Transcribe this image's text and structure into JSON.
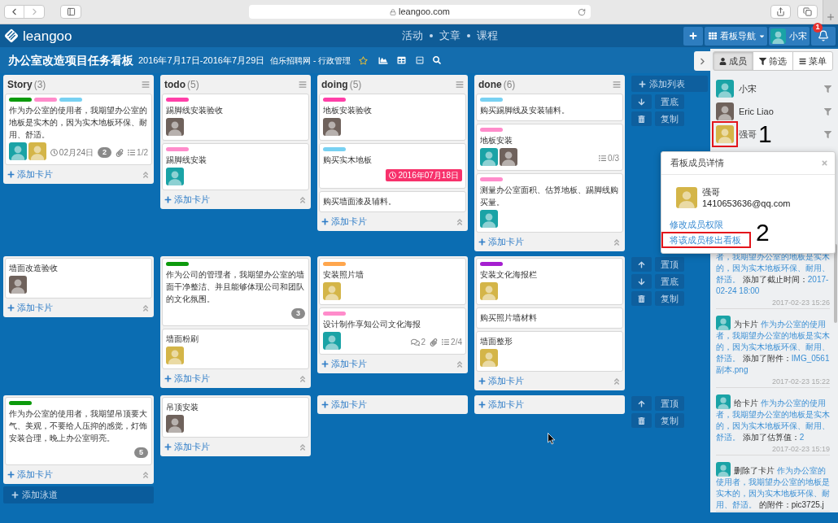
{
  "browser": {
    "url": "leangoo.com"
  },
  "header": {
    "logo": "leangoo",
    "nav": [
      "活动",
      "文章",
      "课程"
    ],
    "board_nav": "看板导航",
    "user": {
      "name": "小宋",
      "avatar": {
        "color": "#1aa3a6"
      }
    },
    "notifications": "1"
  },
  "board": {
    "title": "办公室改造项目任务看板",
    "dates": "2016年7月17日-2016年7月29日",
    "team": "伯乐招聘网 - 行政管理"
  },
  "lists": [
    {
      "name": "Story",
      "count": "(3)"
    },
    {
      "name": "todo",
      "count": "(5)"
    },
    {
      "name": "doing",
      "count": "(5)"
    },
    {
      "name": "done",
      "count": "(6)"
    }
  ],
  "lanes": [
    {
      "add_list": "添加列表",
      "columns": [
        {
          "cards": [
            {
              "labels": [
                {
                  "color": "#0c9a0c"
                },
                {
                  "color": "#ff8ccb"
                },
                {
                  "color": "#78d1f2"
                }
              ],
              "title": "作为办公室的使用者，我期望办公室的地板是实木的，因为实木地板环保、耐用、舒适。",
              "avatars": [
                {
                  "color": "#1aa3a6"
                },
                {
                  "color": "#d4b548"
                }
              ],
              "due": {
                "text": "02月24日",
                "overdue": false
              },
              "estimate": "2",
              "attachment": true,
              "checklist": "1/2"
            }
          ],
          "add_card": "添加卡片"
        },
        {
          "cards": [
            {
              "labels": [
                {
                  "color": "#ff3fa8"
                }
              ],
              "title": "踢脚线安装验收",
              "avatars": [
                {
                  "color": "#6f625c"
                }
              ]
            },
            {
              "labels": [
                {
                  "color": "#ff8ccb"
                }
              ],
              "title": "踢脚线安装",
              "avatars": [
                {
                  "color": "#1aa3a6"
                }
              ]
            }
          ],
          "add_card": "添加卡片"
        },
        {
          "cards": [
            {
              "labels": [
                {
                  "color": "#ff3fa8"
                }
              ],
              "title": "地板安装验收",
              "avatars": [
                {
                  "color": "#6f625c"
                }
              ]
            },
            {
              "labels": [
                {
                  "color": "#78d1f2"
                }
              ],
              "title": "购买实木地板",
              "due": {
                "text": "2016年07月18日",
                "overdue": true
              }
            },
            {
              "title": "购买墙面漆及辅料。"
            }
          ],
          "add_card": "添加卡片"
        },
        {
          "cards": [
            {
              "labels": [
                {
                  "color": "#78d1f2"
                }
              ],
              "title": "购买踢脚线及安装辅料。"
            },
            {
              "labels": [
                {
                  "color": "#ff8ccb"
                }
              ],
              "title": "地板安装",
              "avatars": [
                {
                  "color": "#1aa3a6"
                },
                {
                  "color": "#6f625c"
                }
              ],
              "checklist": "0/3"
            },
            {
              "labels": [
                {
                  "color": "#ff8ccb"
                }
              ],
              "title": "测量办公室面积、估算地板、踢脚线购买量。",
              "avatars": [
                {
                  "color": "#1aa3a6"
                }
              ]
            }
          ],
          "add_card": "添加卡片"
        }
      ],
      "actions": [
        {
          "kind": "down",
          "label": "置底"
        },
        {
          "kind": "delete",
          "label": "复制"
        }
      ]
    },
    {
      "columns": [
        {
          "cards": [
            {
              "title": "墙面改造验收",
              "avatars": [
                {
                  "color": "#6f625c"
                }
              ]
            }
          ],
          "add_card": "添加卡片"
        },
        {
          "cards": [
            {
              "labels": [
                {
                  "color": "#0c9a0c"
                }
              ],
              "title": "作为公司的管理者，我期望办公室的墙面干净整洁、并且能够体现公司和团队的文化氛围。",
              "estimate": "3"
            },
            {
              "title": "墙面粉刷",
              "avatars": [
                {
                  "color": "#d4b548"
                }
              ]
            }
          ],
          "add_card": "添加卡片"
        },
        {
          "cards": [
            {
              "labels": [
                {
                  "color": "#ffa64d"
                }
              ],
              "title": "安装照片墙",
              "avatars": [
                {
                  "color": "#d4b548"
                }
              ]
            },
            {
              "labels": [
                {
                  "color": "#ff8ccb"
                }
              ],
              "title": "设计制作享知公司文化海报",
              "avatars": [
                {
                  "color": "#1aa3a6"
                }
              ],
              "comments": "2",
              "attachment": true,
              "checklist": "2/4"
            }
          ],
          "add_card": "添加卡片"
        },
        {
          "cards": [
            {
              "labels": [
                {
                  "color": "#a51fd0"
                }
              ],
              "title": "安装文化海报栏",
              "avatars": [
                {
                  "color": "#d4b548"
                }
              ]
            },
            {
              "title": "购买照片墙材料"
            },
            {
              "title": "墙面整形",
              "avatars": [
                {
                  "color": "#d4b548"
                }
              ]
            }
          ],
          "add_card": "添加卡片"
        }
      ],
      "actions": [
        {
          "kind": "up",
          "label": "置顶"
        },
        {
          "kind": "down",
          "label": "置底"
        },
        {
          "kind": "delete",
          "label": "复制"
        }
      ]
    },
    {
      "columns": [
        {
          "cards": [
            {
              "labels": [
                {
                  "color": "#0c9a0c"
                }
              ],
              "title": "作为办公室的使用者，我期望吊顶要大气、美观，不要给人压抑的感觉，灯饰安装合理，晚上办公室明亮。",
              "estimate": "5"
            }
          ],
          "add_card": "添加卡片"
        },
        {
          "cards": [
            {
              "title": "吊顶安装",
              "avatars": [
                {
                  "color": "#6f625c"
                }
              ]
            }
          ],
          "add_card": "添加卡片"
        },
        {
          "add_card": "添加卡片"
        },
        {
          "add_card": "添加卡片"
        }
      ],
      "actions": [
        {
          "kind": "up",
          "label": "置顶"
        },
        {
          "kind": "delete",
          "label": "复制"
        }
      ]
    }
  ],
  "add_lane": "添加泳道",
  "panel": {
    "tabs": [
      {
        "label": "成员",
        "selected": true
      },
      {
        "label": "筛选",
        "selected": false
      },
      {
        "label": "菜单",
        "selected": false
      }
    ],
    "members": [
      {
        "name": "小宋",
        "avatar": {
          "color": "#1aa3a6"
        },
        "highlighted": false
      },
      {
        "name": "Eric Liao",
        "avatar": {
          "color": "#6f625c"
        },
        "highlighted": false
      },
      {
        "name": "强哥",
        "avatar": {
          "color": "#d4b548"
        },
        "highlighted": true,
        "annotation": "1"
      }
    ],
    "activity": [
      {
        "segments": [
          {
            "kind": "link",
            "text": "者，我期望办公室的地板是实木的，因为实木地板环保、耐用、舒适。"
          },
          {
            "kind": "plain",
            "text": " 添加了截止时间："
          },
          {
            "kind": "link",
            "text": "2017-02-24 18:00"
          }
        ],
        "time": "2017-02-23 15:26"
      },
      {
        "avatar": {
          "color": "#1aa3a6"
        },
        "segments": [
          {
            "kind": "plain",
            "text": "为卡片 "
          },
          {
            "kind": "link",
            "text": "作为办公室的使用者，我期望办公室的地板是实木的，因为实木地板环保、耐用、舒适。"
          },
          {
            "kind": "plain",
            "text": " 添加了附件："
          },
          {
            "kind": "link",
            "text": "IMG_0561副本.png"
          }
        ],
        "time": "2017-02-23 15:22"
      },
      {
        "avatar": {
          "color": "#1aa3a6"
        },
        "segments": [
          {
            "kind": "plain",
            "text": "给卡片 "
          },
          {
            "kind": "link",
            "text": "作为办公室的使用者，我期望办公室的地板是实木的，因为实木地板环保、耐用、舒适。"
          },
          {
            "kind": "plain",
            "text": " 添加了估算值："
          },
          {
            "kind": "link",
            "text": "2"
          }
        ],
        "time": "2017-02-23 15:19"
      },
      {
        "avatar": {
          "color": "#1aa3a6"
        },
        "segments": [
          {
            "kind": "plain",
            "text": "删除了卡片 "
          },
          {
            "kind": "link",
            "text": "作为办公室的使用者，我期望办公室的地板是实木的，因为实木地板环保、耐用、舒适。"
          },
          {
            "kind": "plain",
            "text": " 的附件：pic3725.j"
          }
        ]
      }
    ]
  },
  "popup": {
    "title": "看板成员详情",
    "member": {
      "name": "强哥",
      "email": "1410653636@qq.com",
      "avatar": {
        "color": "#d4b548"
      }
    },
    "links": [
      {
        "label": "修改成员权限",
        "highlighted": false
      },
      {
        "label": "将该成员移出看板",
        "highlighted": true
      }
    ],
    "annotation": "2"
  }
}
